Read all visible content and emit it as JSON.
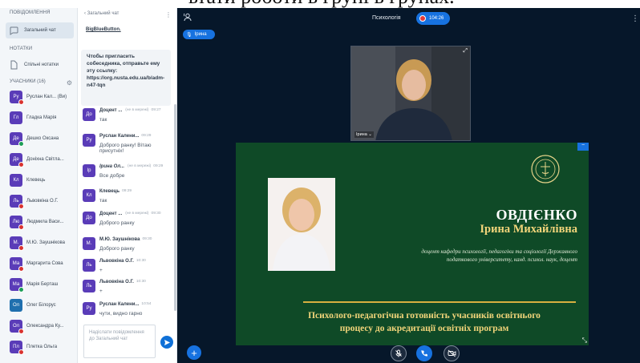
{
  "sidebar": {
    "messages_header": "ПОВІДОМЛЕННЯ",
    "public_chat_label": "Загальний чат",
    "notes_header": "НОТАТКИ",
    "shared_notes_label": "Спільні нотатки",
    "users_header": "УЧАСНИКИ (16)",
    "users": [
      {
        "initials": "Ру",
        "name": "Руслан Кал... (Ви)",
        "color": "#5a3cb8",
        "status": "#d9322f"
      },
      {
        "initials": "Гл",
        "name": "Гладка Марія",
        "color": "#5a3cb8",
        "status": ""
      },
      {
        "initials": "Де",
        "name": "Дешко Оксана",
        "color": "#5a3cb8",
        "status": "#1c9e57"
      },
      {
        "initials": "Де",
        "name": "Доніхна Світла...",
        "color": "#5a3cb8",
        "status": "#d9322f"
      },
      {
        "initials": "Кл",
        "name": "Клевець",
        "color": "#5a3cb8",
        "status": ""
      },
      {
        "initials": "Ль",
        "name": "Львовкіна О.Г.",
        "color": "#5a3cb8",
        "status": "#d9322f"
      },
      {
        "initials": "Лю",
        "name": "Людмила Васи...",
        "color": "#5a3cb8",
        "status": "#d9322f"
      },
      {
        "initials": "М.",
        "name": "М.Ю. Заушнікова",
        "color": "#5a3cb8",
        "status": "#d9322f"
      },
      {
        "initials": "Ма",
        "name": "Маргарита Сова",
        "color": "#5a3cb8",
        "status": "#d9322f"
      },
      {
        "initials": "Ма",
        "name": "Марія Берташ",
        "color": "#5a3cb8",
        "status": "#1c9e57"
      },
      {
        "initials": "Ол",
        "name": "Олег Білорус",
        "color": "#1f6fae",
        "status": ""
      },
      {
        "initials": "Ол",
        "name": "Олександра Ку...",
        "color": "#5a3cb8",
        "status": "#d9322f"
      },
      {
        "initials": "Пл",
        "name": "Плетка Ольга",
        "color": "#5a3cb8",
        "status": "#d9322f"
      }
    ]
  },
  "chat": {
    "back_label": "‹  Загальний чат",
    "menu_icon": "⋮",
    "link_text": "BigBlueButton.",
    "invite_text": "Чтобы пригласить собеседника, отправьте ему эту ссылку: https://org.nusta.edu.ua/b/adm-n47-tqn",
    "messages": [
      {
        "initials": "До",
        "name": "Доцент ...",
        "note": "(не в мережі)",
        "time": "09:27",
        "text": "так",
        "italic": false
      },
      {
        "initials": "Ру",
        "name": "Руслан Калени...",
        "note": "",
        "time": "09:29",
        "text": "Доброго ранку! Вітаю",
        "text2": "присутніх!",
        "italic": false
      },
      {
        "initials": "Ір",
        "name": "Ірина Ол...",
        "note": "(не в мережі)",
        "time": "09:29",
        "text": "Все добре",
        "italic": true
      },
      {
        "initials": "Кл",
        "name": "Клевець",
        "note": "",
        "time": "09:29",
        "text": "так",
        "italic": false
      },
      {
        "initials": "До",
        "name": "Доцент ...",
        "note": "(не в мережі)",
        "time": "09:30",
        "text": "Доброго ранку",
        "italic": false
      },
      {
        "initials": "М.",
        "name": "М.Ю. Заушнікова",
        "note": "",
        "time": "09:30",
        "text": "Доброго ранку",
        "italic": false
      },
      {
        "initials": "Ль",
        "name": "Львовкіна О.Г.",
        "note": "",
        "time": "10:30",
        "text": "+",
        "italic": false
      },
      {
        "initials": "Ль",
        "name": "Львовкіна О.Г.",
        "note": "",
        "time": "10:30",
        "text": "+",
        "italic": false
      },
      {
        "initials": "Ру",
        "name": "Руслан Калени...",
        "note": "",
        "time": "10:54",
        "text": "чути, видно гарно",
        "italic": false
      }
    ],
    "input_placeholder": "Надіслати повідомлення до Загальний чат"
  },
  "stage": {
    "meeting_title": "Психологія",
    "recording_time": "104:26",
    "talker_name": "Ірина",
    "webcam_name": "Ірина ⌄",
    "slide": {
      "surname": "ОВДІЄНКО",
      "given_names": "Ірина Михайлівна",
      "desc_line1": "доцент кафедри психології, педагогіки та соціології Державного",
      "desc_line2": "податкового університету, канд. психол. наук, доцент",
      "topic_line1": "Психолого-педагогічна готовність учасників освітнього",
      "topic_line2": "процесу до акредитації освітніх програм"
    }
  }
}
